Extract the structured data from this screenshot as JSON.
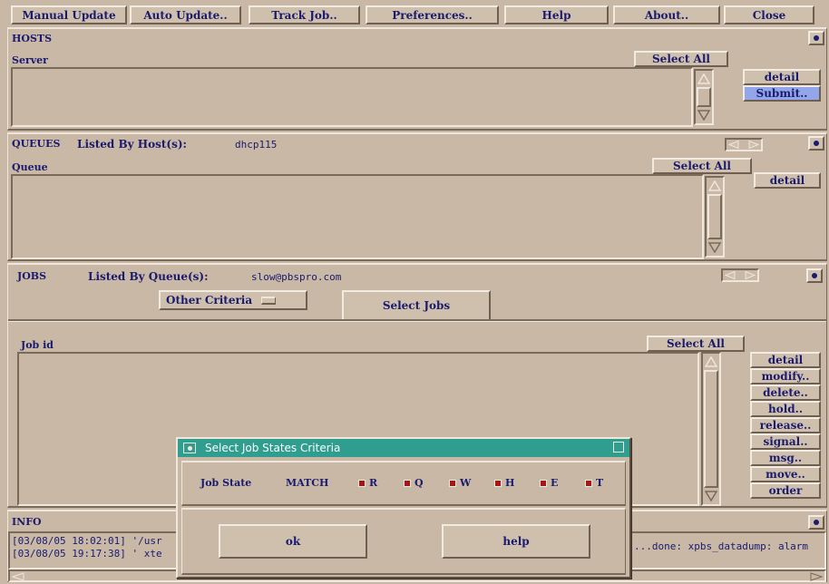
{
  "menubar": {
    "manual_update": "Manual Update",
    "auto_update": "Auto Update..",
    "track_job": "Track Job..",
    "preferences": "Preferences..",
    "help": "Help",
    "about": "About..",
    "close": "Close"
  },
  "hosts": {
    "title": "HOSTS",
    "column": "Server",
    "select_all": "Select All",
    "detail": "detail",
    "submit": "Submit.."
  },
  "queues": {
    "title": "QUEUES",
    "listed_by_label": "Listed By Host(s):",
    "listed_by_value": "dhcp115",
    "column": "Queue",
    "select_all": "Select All",
    "detail": "detail"
  },
  "jobs": {
    "title": "JOBS",
    "listed_by_label": "Listed By Queue(s):",
    "listed_by_value": "slow@pbspro.com",
    "other_criteria": "Other Criteria",
    "select_jobs": "Select Jobs",
    "column": "Job id",
    "select_all": "Select All",
    "actions": [
      "detail",
      "modify..",
      "delete..",
      "hold..",
      "release..",
      "signal..",
      "msg..",
      "move..",
      "order"
    ]
  },
  "info": {
    "title": "INFO",
    "lines": [
      "[03/08/05 18:02:01] '/usr",
      "[03/08/05 19:17:38] ' xte"
    ],
    "right_text": "...done: xpbs_datadump: alarm"
  },
  "dialog": {
    "title": "Select Job States Criteria",
    "job_state_label": "Job State",
    "match_label": "MATCH",
    "states": [
      "R",
      "Q",
      "W",
      "H",
      "E",
      "T"
    ],
    "ok": "ok",
    "help": "help",
    "title_color": "#2f9e8e"
  }
}
